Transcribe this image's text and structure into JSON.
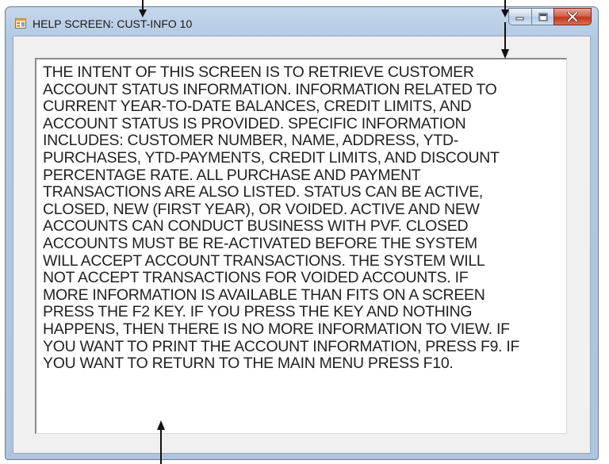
{
  "window": {
    "title": "HELP SCREEN: CUST-INFO 10",
    "icon": "app-form-icon"
  },
  "caption_buttons": {
    "minimize_icon": "minimize-icon",
    "maximize_icon": "maximize-icon",
    "close_icon": "close-icon"
  },
  "help": {
    "text": "THE INTENT OF THIS SCREEN IS TO RETRIEVE CUSTOMER\nACCOUNT STATUS INFORMATION.  INFORMATION RELATED TO\nCURRENT YEAR-TO-DATE BALANCES, CREDIT LIMITS, AND\nACCOUNT STATUS IS PROVIDED.  SPECIFIC INFORMATION\nINCLUDES: CUSTOMER NUMBER, NAME, ADDRESS, YTD-\nPURCHASES, YTD-PAYMENTS, CREDIT LIMITS, AND DISCOUNT\nPERCENTAGE RATE. ALL PURCHASE AND PAYMENT\nTRANSACTIONS ARE ALSO LISTED. STATUS CAN BE ACTIVE,\nCLOSED, NEW (FIRST YEAR), OR VOIDED. ACTIVE AND NEW\nACCOUNTS CAN CONDUCT BUSINESS WITH PVF. CLOSED\nACCOUNTS MUST BE RE-ACTIVATED BEFORE THE SYSTEM\nWILL ACCEPT ACCOUNT TRANSACTIONS. THE SYSTEM WILL\nNOT ACCEPT TRANSACTIONS FOR VOIDED ACCOUNTS. IF\nMORE INFORMATION IS AVAILABLE THAN FITS ON A SCREEN\nPRESS THE F2 KEY. IF YOU PRESS THE KEY AND NOTHING\nHAPPENS, THEN THERE IS NO MORE INFORMATION TO VIEW. IF\nYOU WANT TO PRINT THE ACCOUNT INFORMATION, PRESS F9. IF\nYOU WANT TO RETURN TO THE MAIN MENU PRESS F10."
  },
  "colors": {
    "title_bar": "#b9cde5",
    "client_background": "#f0f0f0",
    "close_button": "#c9452c",
    "text": "#222222"
  }
}
